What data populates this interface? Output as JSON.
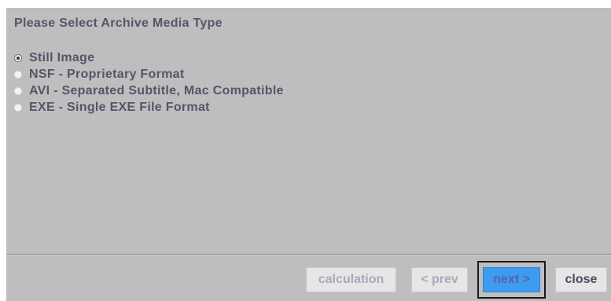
{
  "dialog": {
    "heading": "Please Select Archive Media Type",
    "options": [
      {
        "label": "Still Image",
        "selected": true
      },
      {
        "label": "NSF - Proprietary Format",
        "selected": false
      },
      {
        "label": "AVI - Separated Subtitle, Mac Compatible",
        "selected": false
      },
      {
        "label": "EXE - Single EXE File Format",
        "selected": false
      }
    ]
  },
  "buttons": {
    "calculation": {
      "label": "calculation",
      "enabled": false
    },
    "prev": {
      "label": "< prev",
      "enabled": false
    },
    "next": {
      "label": "next >",
      "enabled": true,
      "focused": true
    },
    "close": {
      "label": "close",
      "enabled": true
    }
  },
  "colors": {
    "panel_background": "#bebebe",
    "text": "#545668",
    "next_button_fill": "#3d9cf0",
    "disabled_text": "#a8aab8"
  }
}
